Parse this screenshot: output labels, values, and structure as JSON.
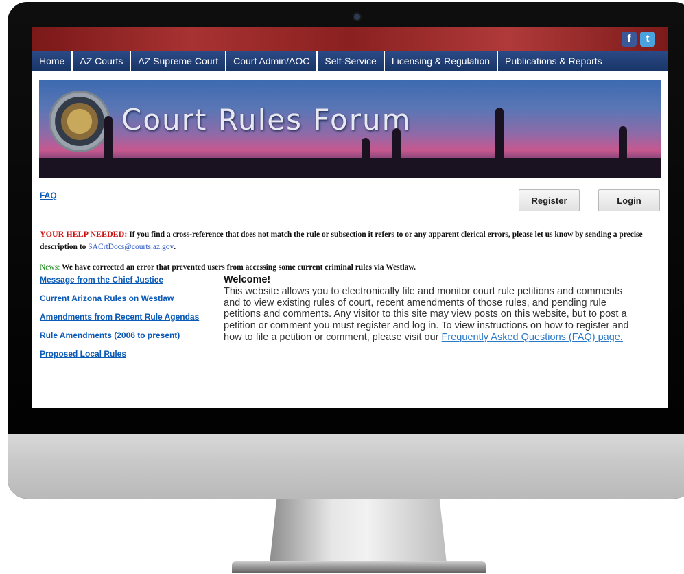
{
  "nav": {
    "items": [
      "Home",
      "AZ Courts",
      "AZ Supreme Court",
      "Court Admin/AOC",
      "Self-Service",
      "Licensing & Regulation",
      "Publications & Reports"
    ]
  },
  "social": {
    "facebook": "f",
    "twitter": "t"
  },
  "banner": {
    "title": "Court Rules Forum"
  },
  "links": {
    "faq": "FAQ"
  },
  "buttons": {
    "register": "Register",
    "login": "Login"
  },
  "help": {
    "label": "YOUR HELP NEEDED:",
    "text": " If you find a cross-reference that does not match the rule or subsection it refers to or any apparent clerical errors, please let us know by sending a precise description to ",
    "email": "SACrtDocs@courts.az.gov",
    "end": "."
  },
  "news": {
    "label": "News:",
    "text": " We have corrected an error that prevented users from accessing some current criminal rules via Westlaw."
  },
  "sidebar": {
    "items": [
      "Message from the Chief Justice",
      "Current Arizona Rules on Westlaw",
      "Amendments from Recent Rule Agendas",
      "Rule Amendments (2006 to present)",
      "Proposed Local Rules"
    ]
  },
  "welcome": {
    "title": "Welcome!",
    "body": "This website allows you to electronically file and monitor court rule petitions and comments and to view existing rules of court, recent amendments of those rules, and pending rule petitions and comments. Any visitor to this site may view posts on this website, but to post a petition or comment you must register and log in. To view instructions on how to register and how to file a petition or comment, please visit our ",
    "faq_link": "Frequently Asked Questions (FAQ) page."
  },
  "colors": {
    "nav_bg": "#1e3c74",
    "link": "#0b5ab6",
    "help_label": "#cc1010",
    "news_label": "#1f8a1f"
  }
}
